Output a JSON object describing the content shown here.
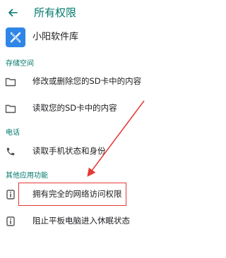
{
  "header": {
    "back_icon": "arrow-left-icon",
    "title": "所有权限"
  },
  "app": {
    "icon": "x-logo-icon",
    "name": "小阳软件库"
  },
  "sections": [
    {
      "title": "存储空间",
      "items": [
        {
          "icon": "folder-icon",
          "label": "修改或删除您的SD卡中的内容"
        },
        {
          "icon": "folder-icon",
          "label": "读取您的SD卡中的内容"
        }
      ]
    },
    {
      "title": "电话",
      "items": [
        {
          "icon": "phone-icon",
          "label": "读取手机状态和身份"
        }
      ]
    },
    {
      "title": "其他应用功能",
      "items": [
        {
          "icon": "info-icon",
          "label": "拥有完全的网络访问权限"
        },
        {
          "icon": "info-icon",
          "label": "阻止平板电脑进入休眠状态"
        }
      ]
    }
  ],
  "colors": {
    "accent": "#00796b",
    "annotation": "#e53935",
    "app_icon_bg": "#2f86e6"
  }
}
